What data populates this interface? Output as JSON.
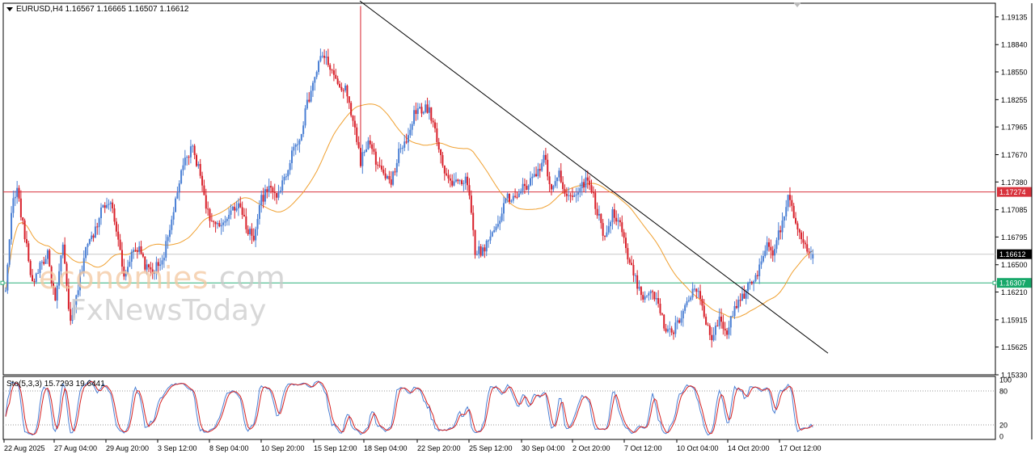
{
  "header": {
    "symbol_line": "EURUSD,H4  1.16567 1.16665 1.16507 1.16612"
  },
  "indicator": {
    "label": "Sto(5,3,3) 15.7293 19.6441"
  },
  "watermark": {
    "line1_main": "economies",
    "line1_suffix": ".com",
    "line2": "FxNewsToday"
  },
  "chart_data": [
    {
      "type": "candlestick",
      "title": "EURUSD,H4",
      "symbol": "EURUSD",
      "timeframe": "H4",
      "ohlc_last": {
        "open": 1.16567,
        "high": 1.16665,
        "low": 1.16507,
        "close": 1.16612
      },
      "ylim": [
        1.1533,
        1.1928
      ],
      "y_ticks": [
        "1.19135",
        "1.18840",
        "1.18550",
        "1.18255",
        "1.17965",
        "1.17670",
        "1.17380",
        "1.17085",
        "1.16795",
        "1.16500",
        "1.16210",
        "1.15915",
        "1.15625",
        "1.15330"
      ],
      "x_ticks": [
        "22 Aug 2025",
        "27 Aug 04:00",
        "29 Aug 20:00",
        "3 Sep 12:00",
        "8 Sep 04:00",
        "10 Sep 20:00",
        "15 Sep 12:00",
        "18 Sep 04:00",
        "22 Sep 20:00",
        "25 Sep 12:00",
        "30 Sep 04:00",
        "2 Oct 20:00",
        "7 Oct 12:00",
        "10 Oct 04:00",
        "14 Oct 20:00",
        "17 Oct 12:00"
      ],
      "price_labels": [
        {
          "value": "1.17274",
          "color": "#d8323c",
          "line": "#d8323c"
        },
        {
          "value": "1.16612",
          "color": "#000000",
          "line": "#c8c8c8"
        },
        {
          "value": "1.16307",
          "color": "#17a86a",
          "line": "#2fb07a"
        }
      ],
      "anchors": [
        [
          0,
          1.162
        ],
        [
          3,
          1.171
        ],
        [
          6,
          1.173
        ],
        [
          10,
          1.168
        ],
        [
          14,
          1.163
        ],
        [
          18,
          1.165
        ],
        [
          22,
          1.166
        ],
        [
          26,
          1.161
        ],
        [
          30,
          1.167
        ],
        [
          34,
          1.1585
        ],
        [
          38,
          1.1625
        ],
        [
          42,
          1.167
        ],
        [
          46,
          1.168
        ],
        [
          50,
          1.171
        ],
        [
          54,
          1.172
        ],
        [
          58,
          1.169
        ],
        [
          62,
          1.164
        ],
        [
          66,
          1.166
        ],
        [
          70,
          1.1665
        ],
        [
          74,
          1.1645
        ],
        [
          78,
          1.1645
        ],
        [
          82,
          1.1655
        ],
        [
          86,
          1.1685
        ],
        [
          90,
          1.173
        ],
        [
          94,
          1.176
        ],
        [
          98,
          1.1775
        ],
        [
          102,
          1.1745
        ],
        [
          106,
          1.1705
        ],
        [
          110,
          1.169
        ],
        [
          114,
          1.169
        ],
        [
          118,
          1.171
        ],
        [
          122,
          1.1715
        ],
        [
          126,
          1.169
        ],
        [
          130,
          1.168
        ],
        [
          134,
          1.172
        ],
        [
          138,
          1.173
        ],
        [
          142,
          1.1725
        ],
        [
          146,
          1.174
        ],
        [
          150,
          1.177
        ],
        [
          154,
          1.1785
        ],
        [
          158,
          1.182
        ],
        [
          162,
          1.185
        ],
        [
          166,
          1.1875
        ],
        [
          170,
          1.186
        ],
        [
          174,
          1.184
        ],
        [
          178,
          1.1835
        ],
        [
          182,
          1.1805
        ],
        [
          186,
          1.176
        ],
        [
          190,
          1.178
        ],
        [
          194,
          1.176
        ],
        [
          198,
          1.1745
        ],
        [
          202,
          1.1735
        ],
        [
          206,
          1.177
        ],
        [
          210,
          1.178
        ],
        [
          214,
          1.181
        ],
        [
          218,
          1.1815
        ],
        [
          222,
          1.1815
        ],
        [
          226,
          1.1785
        ],
        [
          230,
          1.175
        ],
        [
          234,
          1.1735
        ],
        [
          238,
          1.174
        ],
        [
          242,
          1.174
        ],
        [
          246,
          1.1665
        ],
        [
          250,
          1.1665
        ],
        [
          254,
          1.168
        ],
        [
          258,
          1.1695
        ],
        [
          262,
          1.172
        ],
        [
          266,
          1.172
        ],
        [
          270,
          1.173
        ],
        [
          274,
          1.1735
        ],
        [
          278,
          1.1745
        ],
        [
          282,
          1.1765
        ],
        [
          286,
          1.173
        ],
        [
          290,
          1.1745
        ],
        [
          294,
          1.1725
        ],
        [
          298,
          1.1725
        ],
        [
          302,
          1.1735
        ],
        [
          306,
          1.174
        ],
        [
          310,
          1.1705
        ],
        [
          314,
          1.168
        ],
        [
          318,
          1.1705
        ],
        [
          322,
          1.1695
        ],
        [
          326,
          1.1655
        ],
        [
          330,
          1.1635
        ],
        [
          334,
          1.1615
        ],
        [
          338,
          1.1625
        ],
        [
          342,
          1.1605
        ],
        [
          346,
          1.158
        ],
        [
          350,
          1.158
        ],
        [
          354,
          1.1595
        ],
        [
          358,
          1.1615
        ],
        [
          362,
          1.1625
        ],
        [
          366,
          1.1595
        ],
        [
          370,
          1.157
        ],
        [
          374,
          1.159
        ],
        [
          378,
          1.1575
        ],
        [
          382,
          1.1605
        ],
        [
          386,
          1.1615
        ],
        [
          390,
          1.163
        ],
        [
          394,
          1.164
        ],
        [
          398,
          1.167
        ],
        [
          402,
          1.1665
        ],
        [
          406,
          1.169
        ],
        [
          410,
          1.172
        ],
        [
          414,
          1.1695
        ],
        [
          418,
          1.167
        ],
        [
          422,
          1.1661
        ]
      ],
      "trendline": {
        "from": [
          1.19305,
          0.0
        ],
        "to": [
          1.1556,
          1.0
        ]
      },
      "moving_average_color": "#f0a030"
    },
    {
      "type": "line",
      "title": "Sto(5,3,3) 15.7293 19.6441",
      "ylim": [
        0,
        100
      ],
      "y_ticks": [
        "100",
        "80",
        "20",
        "0"
      ],
      "levels": [
        80,
        20
      ],
      "series": [
        {
          "name": "Sto main",
          "color": "#4a7fd4"
        },
        {
          "name": "Sto signal",
          "color": "#d62020"
        }
      ],
      "last_values": {
        "main": 15.7293,
        "signal": 19.6441
      }
    }
  ],
  "colors": {
    "bull": "#4a7fd4",
    "bear": "#d8202a",
    "trendline": "#000000",
    "grid_dots": "#9a9a9a",
    "frame": "#000000"
  }
}
